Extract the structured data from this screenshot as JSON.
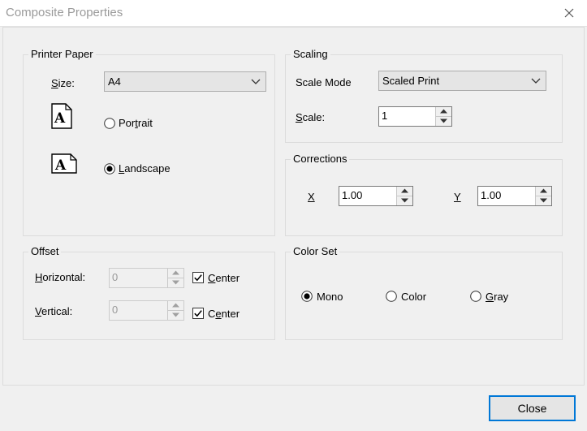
{
  "window": {
    "title": "Composite Properties"
  },
  "printer_paper": {
    "label": "Printer Paper",
    "size_label": "Size:",
    "size_value": "A4",
    "portrait_label": "Portrait",
    "landscape_label": "Landscape",
    "selected": "Landscape"
  },
  "scaling": {
    "label": "Scaling",
    "scale_mode_label": "Scale Mode",
    "scale_mode_value": "Scaled Print",
    "scale_label": "Scale:",
    "scale_value": "1"
  },
  "corrections": {
    "label": "Corrections",
    "x_label": "X",
    "x_value": "1.00",
    "y_label": "Y",
    "y_value": "1.00"
  },
  "offset": {
    "label": "Offset",
    "horizontal_label": "Horizontal:",
    "horizontal_value": "0",
    "vertical_label": "Vertical:",
    "vertical_value": "0",
    "center_label": "Center",
    "horizontal_center_checked": true,
    "vertical_center_checked": true
  },
  "color_set": {
    "label": "Color Set",
    "mono_label": "Mono",
    "color_label": "Color",
    "gray_label": "Gray",
    "selected": "Mono"
  },
  "buttons": {
    "close_label": "Close"
  },
  "icons": {
    "window_close": "close-icon",
    "portrait": "portrait-page-icon",
    "landscape": "landscape-page-icon",
    "dropdown": "chevron-down-icon",
    "spin_up": "spin-up-icon",
    "spin_down": "spin-down-icon"
  },
  "colors": {
    "focus_border": "#0078d7",
    "title_text": "#9a9a9a"
  }
}
